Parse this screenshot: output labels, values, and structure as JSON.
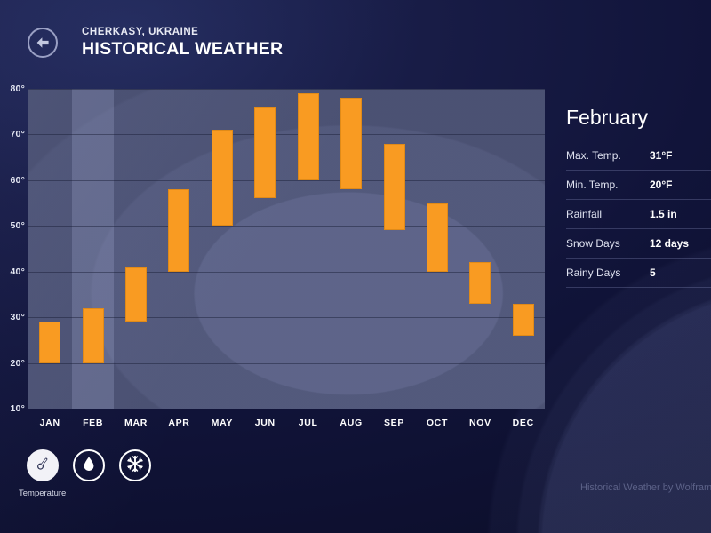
{
  "header": {
    "back_icon": "arrow-left-icon",
    "location": "CHERKASY, UKRAINE",
    "title": "HISTORICAL WEATHER"
  },
  "chart_data": {
    "type": "bar",
    "title": "",
    "subtitle": "",
    "xlabel": "",
    "ylabel": "",
    "ylim": [
      10,
      80
    ],
    "yticks": [
      "10°",
      "20°",
      "30°",
      "40°",
      "50°",
      "60°",
      "70°",
      "80°"
    ],
    "ytick_values": [
      10,
      20,
      30,
      40,
      50,
      60,
      70,
      80
    ],
    "grid": true,
    "legend": "none",
    "bar_color": "#f99b22",
    "plot_bg": "#414767",
    "highlight_category": "FEB",
    "categories": [
      "JAN",
      "FEB",
      "MAR",
      "APR",
      "MAY",
      "JUN",
      "JUL",
      "AUG",
      "SEP",
      "OCT",
      "NOV",
      "DEC"
    ],
    "series": [
      {
        "name": "Min. Temp.",
        "values": [
          20,
          20,
          29,
          40,
          50,
          56,
          60,
          58,
          49,
          40,
          33,
          26
        ]
      },
      {
        "name": "Max. Temp.",
        "values": [
          29,
          32,
          41,
          58,
          71,
          76,
          79,
          78,
          68,
          55,
          42,
          33
        ]
      }
    ]
  },
  "panel": {
    "month": "February",
    "rows": [
      {
        "key": "Max. Temp.",
        "value": "31°F"
      },
      {
        "key": "Min. Temp.",
        "value": "20°F"
      },
      {
        "key": "Rainfall",
        "value": "1.5 in"
      },
      {
        "key": "Snow Days",
        "value": "12 days"
      },
      {
        "key": "Rainy Days",
        "value": "5"
      }
    ]
  },
  "toolbar": {
    "items": [
      {
        "icon": "thermometer-icon",
        "label": "Temperature",
        "active": true
      },
      {
        "icon": "raindrop-icon",
        "label": "",
        "active": false
      },
      {
        "icon": "snowflake-icon",
        "label": "",
        "active": false
      }
    ],
    "active_caption": "Temperature"
  },
  "footer": {
    "attribution": "Historical Weather by Wolfram|Alp"
  }
}
